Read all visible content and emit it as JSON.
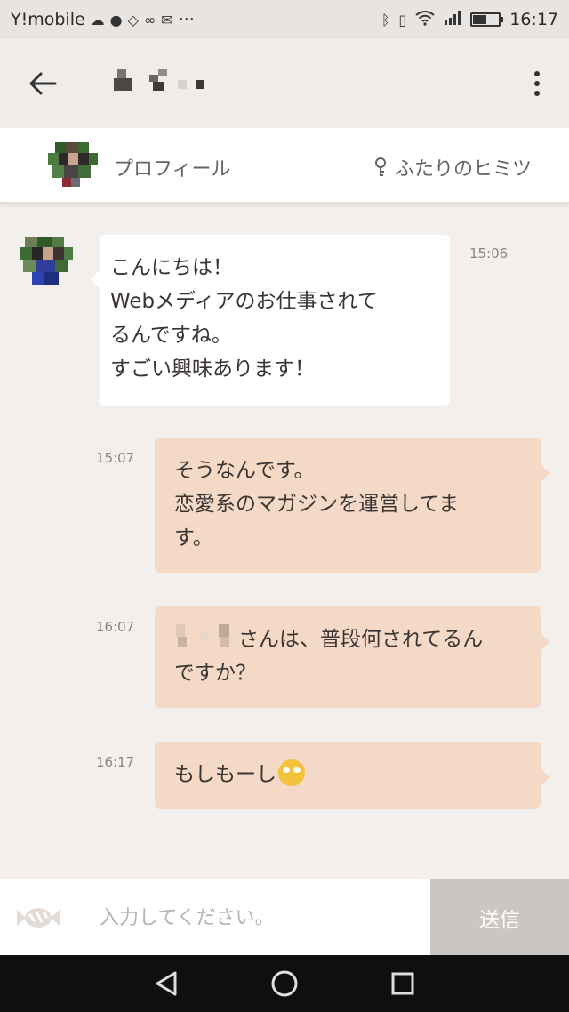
{
  "status_bar": {
    "carrier": "Y!mobile",
    "overflow": "···",
    "time": "16:17",
    "battery_level": 0.5,
    "icons": [
      "cloud-icon",
      "messenger-icon",
      "diamond-icon",
      "link-icon",
      "mail-icon",
      "bluetooth-icon",
      "vibrate-icon",
      "wifi-icon",
      "signal-icon",
      "battery-icon"
    ]
  },
  "app_bar": {
    "back_icon": "arrow-left-icon",
    "menu_icon": "more-vertical-icon"
  },
  "profile_bar": {
    "profile_label": "プロフィール",
    "secret_label": "ふたりのヒミツ",
    "secret_icon": "key-icon"
  },
  "messages": [
    {
      "direction": "incoming",
      "time": "15:06",
      "lines": [
        "こんにちは！",
        "Webメディアのお仕事されて",
        "るんですね。",
        "すごい興味あります！"
      ]
    },
    {
      "direction": "outgoing",
      "time": "15:07",
      "lines": [
        "そうなんです。",
        "恋愛系のマガジンを運営してま",
        "す。"
      ]
    },
    {
      "direction": "outgoing",
      "time": "16:07",
      "lines": [
        "さんは、普段何されてるん",
        "ですか？"
      ]
    },
    {
      "direction": "outgoing",
      "time": "16:17",
      "lines": [
        "もしもーし"
      ],
      "emoji": "rolling-eyes-emoji"
    }
  ],
  "input_bar": {
    "placeholder": "入力してください。",
    "send_label": "送信",
    "candy_icon": "candy-icon"
  },
  "nav_bar": {
    "icons": [
      "nav-back-icon",
      "nav-home-icon",
      "nav-recents-icon"
    ]
  },
  "colors": {
    "background": "#f3efec",
    "outgoing_bubble": "#f3d9c6",
    "incoming_bubble": "#ffffff",
    "send_button": "#ccc6c2"
  }
}
